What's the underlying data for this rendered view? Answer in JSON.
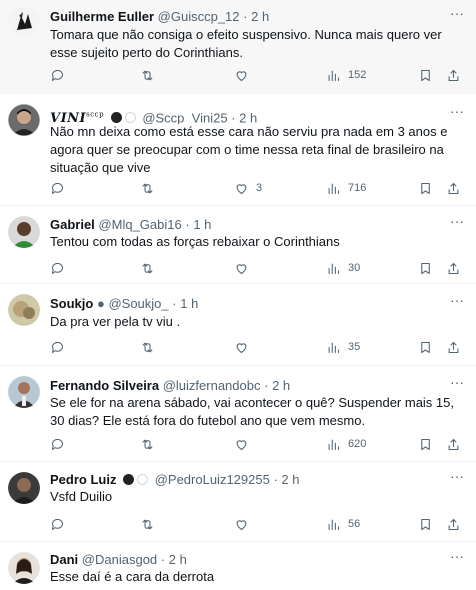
{
  "tweets": [
    {
      "name": "Guilherme Euller",
      "handle": "@Guisccp_12",
      "sep": "·",
      "time": "2 h",
      "text": "Tomara que não consiga o efeito suspensivo. Nunca mais quero ver esse sujeito perto do Corinthians.",
      "replies": "",
      "retweets": "",
      "likes": "",
      "views": "152"
    },
    {
      "name": "VINI",
      "name_sup": "sccp",
      "handle": "@Sccp_Vini25",
      "sep": "·",
      "time": "2 h",
      "text": "Não mn deixa como está esse cara não serviu pra nada em 3 anos e agora quer se preocupar com o time nessa reta final de brasileiro na situação que vive",
      "replies": "",
      "retweets": "",
      "likes": "3",
      "views": "716"
    },
    {
      "name": "Gabriel",
      "handle": "@Mlq_Gabi16",
      "sep": "·",
      "time": "1 h",
      "text": "Tentou com todas as forças rebaixar o Corinthians",
      "replies": "",
      "retweets": "",
      "likes": "",
      "views": "30"
    },
    {
      "name": "Soukjo",
      "handle": "@Soukjo_",
      "sep": "·",
      "time": "1 h",
      "text": "Da pra ver pela tv viu .",
      "replies": "",
      "retweets": "",
      "likes": "",
      "views": "35"
    },
    {
      "name": "Fernando Silveira",
      "handle": "@luizfernandobc",
      "sep": "·",
      "time": "2 h",
      "text": "Se ele for na arena sábado, vai acontecer o quê? Suspender mais 15, 30 dias? Ele está fora do futebol ano que vem mesmo.",
      "replies": "",
      "retweets": "",
      "likes": "",
      "views": "620"
    },
    {
      "name": "Pedro Luiz",
      "handle": "@PedroLuiz129255",
      "sep": "·",
      "time": "2 h",
      "text": "Vsfd Duilio",
      "replies": "",
      "retweets": "",
      "likes": "",
      "views": "56"
    },
    {
      "name": "Dani",
      "handle": "@Daniasgod",
      "sep": "·",
      "time": "2 h",
      "text": "Esse daí é a cara da derrota",
      "replies": "",
      "retweets": "",
      "likes": "",
      "views": ""
    }
  ],
  "more_glyph": "···",
  "icons": {
    "reply": "reply-icon",
    "retweet": "retweet-icon",
    "like": "heart-icon",
    "views": "views-icon",
    "bookmark": "bookmark-icon",
    "share": "share-icon"
  }
}
